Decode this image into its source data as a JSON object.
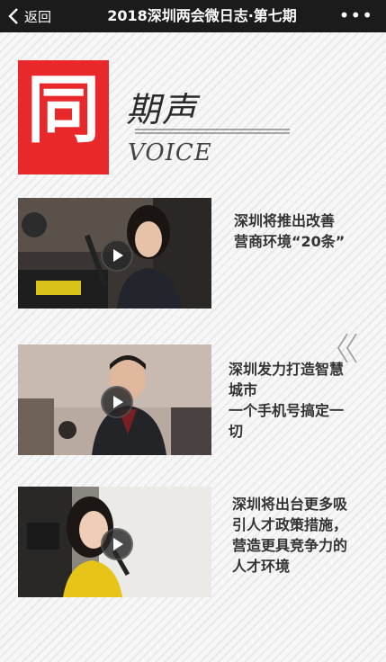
{
  "topbar": {
    "back_label": "返回",
    "title": "2018深圳两会微日志·第七期",
    "more": "•••"
  },
  "header": {
    "logo_char": "同",
    "section_title": "期声",
    "section_subtitle": "VOICE",
    "accent_color": "#e8282b"
  },
  "articles": [
    {
      "lines": [
        "深圳将推出改善",
        "营商环境“20条”"
      ]
    },
    {
      "lines": [
        "深圳发力打造智慧",
        "城市",
        "一个手机号搞定一",
        "切"
      ]
    },
    {
      "lines": [
        "深圳将出台更多吸",
        "引人才政策措施，",
        "营造更具竞争力的",
        "人才环境"
      ]
    }
  ]
}
